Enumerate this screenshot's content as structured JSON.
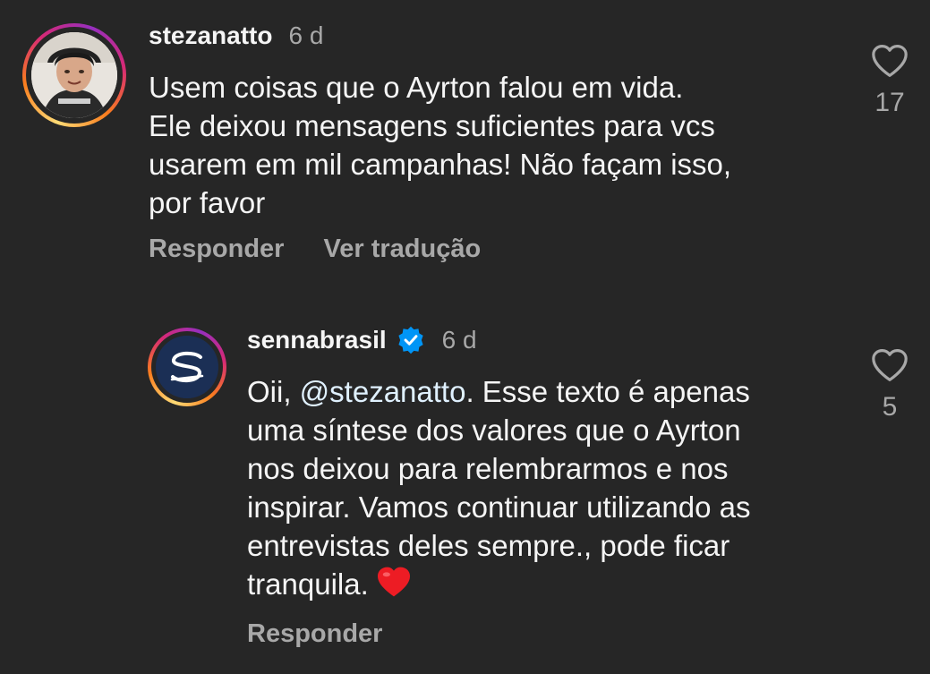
{
  "comments": [
    {
      "username": "stezanatto",
      "time": "6 d",
      "text": "Usem coisas que o Ayrton falou em vida.\nEle deixou mensagens suficientes para vcs\nusarem em mil campanhas! Não façam isso,\npor favor",
      "actions": [
        "Responder",
        "Ver tradução"
      ],
      "likes": "17"
    },
    {
      "username": "sennabrasil",
      "verified": true,
      "time": "6 d",
      "text_prefix": "Oii, ",
      "mention": "@stezanatto",
      "text_rest": ". Esse texto é apenas\numa síntese dos valores que o Ayrton\nnos deixou para relembrarmos e nos\ninspirar. Vamos continuar utilizando as\nentrevistas deles sempre., pode ficar\ntranquila.",
      "actions": [
        "Responder"
      ],
      "likes": "5"
    }
  ],
  "colors": {
    "background": "#262626",
    "primary_text": "#f5f5f5",
    "secondary_text": "#a8a8a8",
    "verified_blue": "#0095f6",
    "heart_red": "#ed4956"
  },
  "icons": [
    "heart-outline-icon",
    "verified-badge-icon",
    "red-heart-emoji"
  ]
}
